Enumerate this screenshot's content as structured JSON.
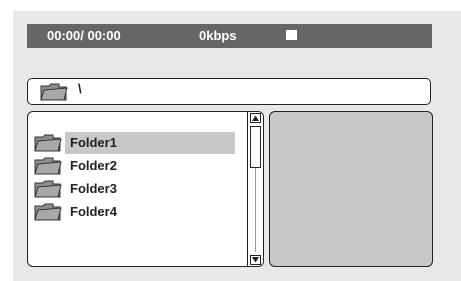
{
  "status_bar": {
    "time": "00:00/ 00:00",
    "bitrate": "0kbps"
  },
  "path_bar": {
    "path": "\\",
    "icon": "folder-icon"
  },
  "file_list": {
    "items": [
      {
        "label": "Folder1",
        "icon": "folder-icon",
        "selected": true
      },
      {
        "label": "Folder2",
        "icon": "folder-icon",
        "selected": false
      },
      {
        "label": "Folder3",
        "icon": "folder-icon",
        "selected": false
      },
      {
        "label": "Folder4",
        "icon": "folder-icon",
        "selected": false
      }
    ]
  },
  "colors": {
    "status_bar_bg": "#666666",
    "panel_bg": "#e8e8e8",
    "selection_bg": "#c8c8c8",
    "preview_bg": "#c8c8c8"
  }
}
